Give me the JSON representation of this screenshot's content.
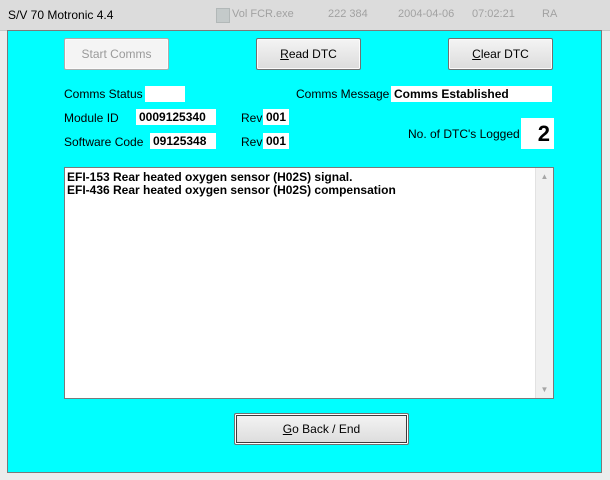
{
  "window": {
    "title": "S/V 70 Motronic 4.4"
  },
  "background_file_row": {
    "name": "Vol FCR.exe",
    "size": "222 384",
    "date": "2004-04-06",
    "time": "07:02:21",
    "attr": "RA"
  },
  "toolbar": {
    "start_comms": "Start Comms",
    "read_dtc_prefix": "R",
    "read_dtc_rest": "ead DTC",
    "clear_dtc_prefix": "C",
    "clear_dtc_rest": "lear DTC"
  },
  "status": {
    "comms_status_label": "Comms Status",
    "comms_status_value": "",
    "comms_message_label": "Comms Message",
    "comms_message_value": "Comms Established",
    "module_id_label": "Module ID",
    "module_id_value": "0009125340",
    "module_rev_label": "Rev",
    "module_rev_value": "001",
    "software_code_label": "Software Code",
    "software_code_value": "09125348",
    "software_rev_label": "Rev",
    "software_rev_value": "001",
    "dtc_count_label": "No. of DTC's Logged",
    "dtc_count_value": "2"
  },
  "dtc_list": [
    "EFI-153 Rear heated oxygen sensor (H02S) signal.",
    "EFI-436 Rear heated oxygen sensor (H02S) compensation"
  ],
  "footer": {
    "go_back_prefix": "G",
    "go_back_rest": "o Back / End"
  },
  "colors": {
    "client_background": "#00ffff",
    "field_background": "#ffffff"
  },
  "icons": {
    "scroll_up": "scroll-up-arrow-icon",
    "scroll_down": "scroll-down-arrow-icon"
  }
}
